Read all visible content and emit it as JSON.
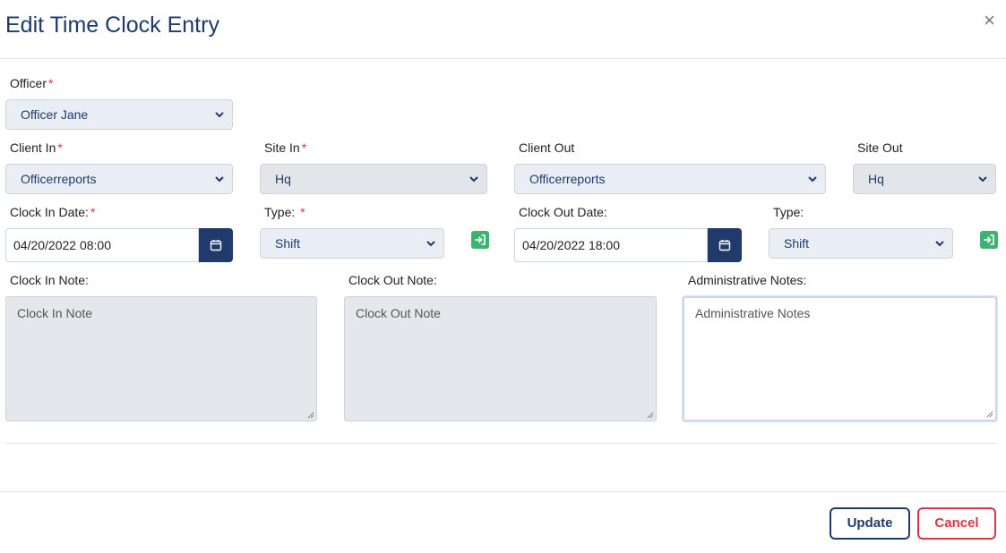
{
  "modal": {
    "title": "Edit Time Clock Entry",
    "close_label": "×"
  },
  "officer": {
    "label": "Officer",
    "value": "Officer Jane"
  },
  "client_in": {
    "label": "Client In",
    "value": "Officerreports"
  },
  "site_in": {
    "label": "Site In",
    "value": "Hq"
  },
  "client_out": {
    "label": "Client Out",
    "value": "Officerreports"
  },
  "site_out": {
    "label": "Site Out",
    "value": "Hq"
  },
  "clock_in": {
    "date_label": "Clock In Date:",
    "date_value": "04/20/2022 08:00",
    "type_label": "Type:",
    "type_value": "Shift"
  },
  "clock_out": {
    "date_label": "Clock Out Date:",
    "date_value": "04/20/2022 18:00",
    "type_label": "Type:",
    "type_value": "Shift"
  },
  "notes": {
    "clock_in_label": "Clock In Note:",
    "clock_in_placeholder": "Clock In Note",
    "clock_out_label": "Clock Out Note:",
    "clock_out_placeholder": "Clock Out Note",
    "admin_label": "Administrative Notes:",
    "admin_placeholder": "Administrative Notes"
  },
  "required_mark": "*",
  "actions": {
    "update_label": "Update",
    "cancel_label": "Cancel"
  },
  "colors": {
    "primary": "#1f3a6b",
    "danger": "#dc3545",
    "success": "#3cb371"
  },
  "icons": {
    "close": "close-icon",
    "chevron": "chevron-down-icon",
    "calendar": "calendar-icon",
    "login": "sign-in-icon"
  }
}
